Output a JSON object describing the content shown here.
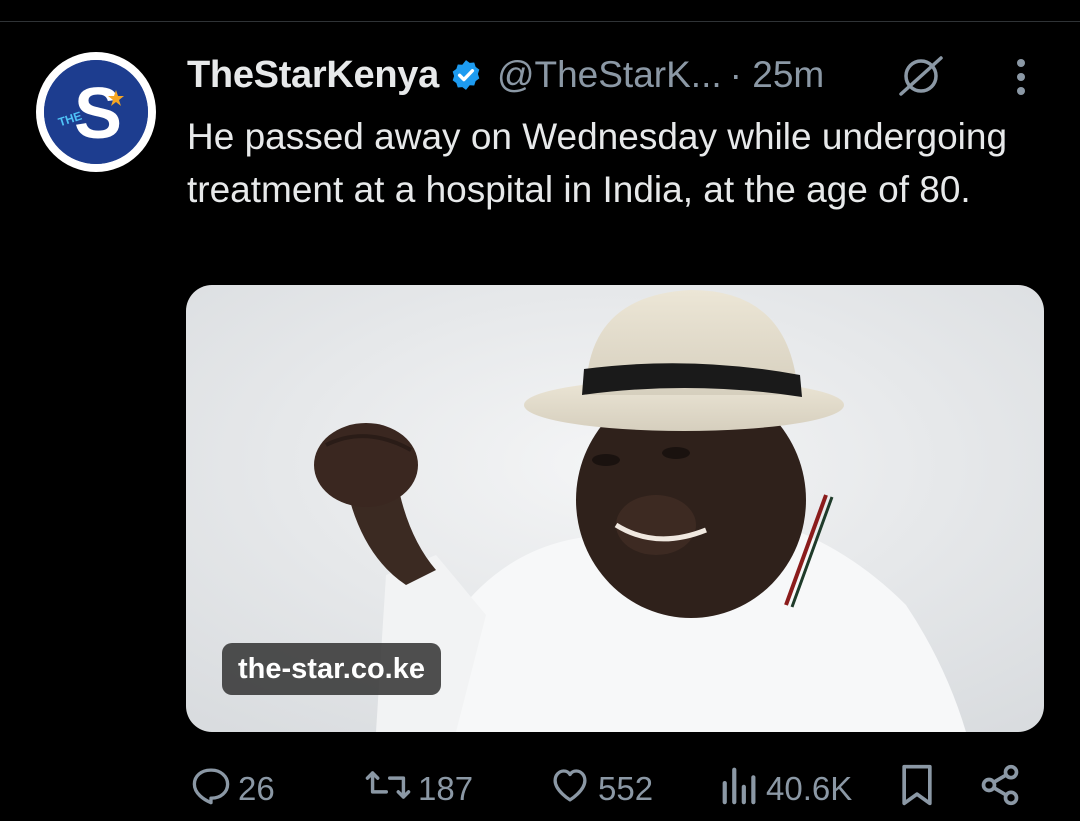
{
  "tweet": {
    "author_name": "TheStarKenya",
    "handle": "@TheStarK...",
    "time": "· 25m",
    "text": "He passed away on Wednesday while undergoing treatment at a hospital in India, at the age of 80.",
    "avatar_letter": "S",
    "avatar_small_text": "THE",
    "media": {
      "source_label": "the-star.co.ke"
    }
  },
  "actions": {
    "replies": "26",
    "reposts": "187",
    "likes": "552",
    "views": "40.6K"
  },
  "icons": {
    "verified": "verified-badge-icon",
    "grok": "grok-icon",
    "more": "more-vertical-icon",
    "reply": "reply-icon",
    "repost": "repost-icon",
    "like": "heart-icon",
    "views": "views-chart-icon",
    "bookmark": "bookmark-icon",
    "share": "share-icon"
  },
  "colors": {
    "background": "#000000",
    "text": "#e7e9ea",
    "muted": "#8b98a5",
    "verified": "#1d9bf0",
    "avatar_blue": "#1d3d8f"
  }
}
